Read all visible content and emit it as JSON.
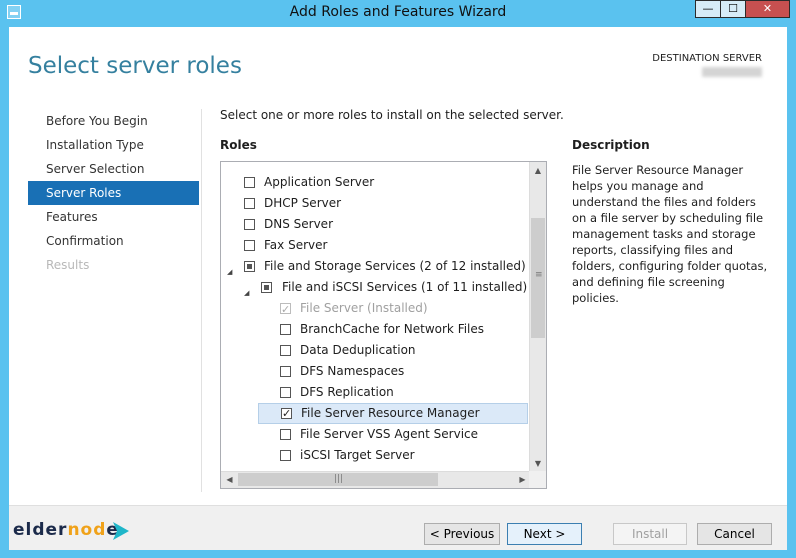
{
  "window": {
    "title": "Add Roles and Features Wizard",
    "controls": {
      "minimize": "—",
      "maximize": "☐",
      "close": "✕"
    },
    "accent": "#5ac2ef"
  },
  "header": {
    "page_title": "Select server roles",
    "destination_label": "DESTINATION SERVER"
  },
  "nav": {
    "items": [
      {
        "label": "Before You Begin",
        "state": "normal"
      },
      {
        "label": "Installation Type",
        "state": "normal"
      },
      {
        "label": "Server Selection",
        "state": "normal"
      },
      {
        "label": "Server Roles",
        "state": "active"
      },
      {
        "label": "Features",
        "state": "normal"
      },
      {
        "label": "Confirmation",
        "state": "normal"
      },
      {
        "label": "Results",
        "state": "disabled"
      }
    ]
  },
  "main": {
    "instruction": "Select one or more roles to install on the selected server.",
    "roles_label": "Roles",
    "roles": [
      {
        "label": "Application Server",
        "state": "unchecked",
        "level": 0
      },
      {
        "label": "DHCP Server",
        "state": "unchecked",
        "level": 0
      },
      {
        "label": "DNS Server",
        "state": "unchecked",
        "level": 0
      },
      {
        "label": "Fax Server",
        "state": "unchecked",
        "level": 0
      },
      {
        "label": "File and Storage Services (2 of 12 installed)",
        "state": "partial",
        "level": 0,
        "expanded": true
      },
      {
        "label": "File and iSCSI Services (1 of 11 installed)",
        "state": "partial",
        "level": 1,
        "expanded": true
      },
      {
        "label": "File Server (Installed)",
        "state": "checked-disabled",
        "level": 2
      },
      {
        "label": "BranchCache for Network Files",
        "state": "unchecked",
        "level": 2
      },
      {
        "label": "Data Deduplication",
        "state": "unchecked",
        "level": 2
      },
      {
        "label": "DFS Namespaces",
        "state": "unchecked",
        "level": 2
      },
      {
        "label": "DFS Replication",
        "state": "unchecked",
        "level": 2
      },
      {
        "label": "File Server Resource Manager",
        "state": "checked",
        "level": 2,
        "selected": true
      },
      {
        "label": "File Server VSS Agent Service",
        "state": "unchecked",
        "level": 2
      },
      {
        "label": "iSCSI Target Server",
        "state": "unchecked",
        "level": 2
      }
    ],
    "description_label": "Description",
    "description_text": "File Server Resource Manager helps you manage and understand the files and folders on a file server by scheduling file management tasks and storage reports, classifying files and folders, configuring folder quotas, and defining file screening policies."
  },
  "footer": {
    "logo_part1": "elder",
    "logo_part2": "nod",
    "logo_part3": "e",
    "prev_label": "< Previous",
    "next_label": "Next >",
    "install_label": "Install",
    "cancel_label": "Cancel"
  }
}
